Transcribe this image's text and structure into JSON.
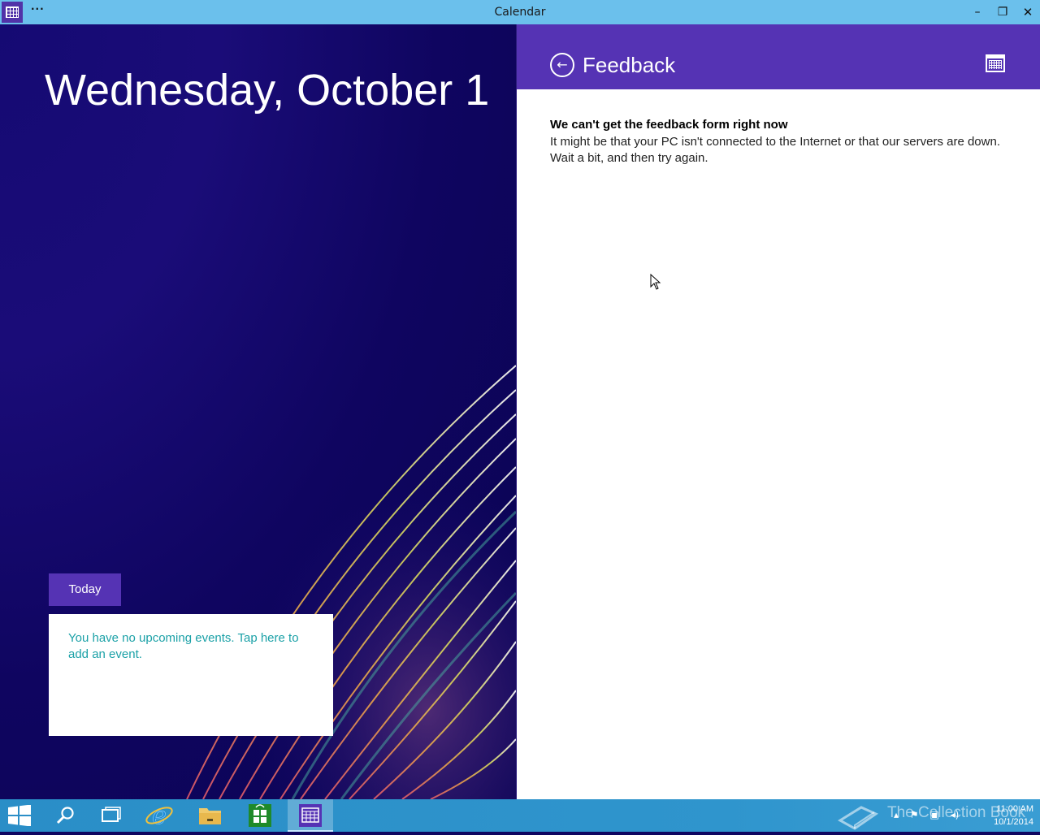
{
  "window": {
    "title": "Calendar",
    "menu_glyph": "···",
    "minimize_glyph": "–",
    "maximize_glyph": "❐",
    "close_glyph": "✕"
  },
  "calendar": {
    "date_heading": "Wednesday, October 1",
    "today_label": "Today",
    "no_events_text": "You have no upcoming events. Tap here to add an event."
  },
  "feedback": {
    "back_glyph": "←",
    "title": "Feedback",
    "error_title": "We can't get the feedback form right now",
    "error_body_line1": "It might be that your PC isn't connected to the Internet or that our servers are down.",
    "error_body_line2": "Wait a bit, and then try again."
  },
  "taskbar": {
    "items": [
      "start-icon",
      "search-icon",
      "task-view-icon",
      "internet-explorer-icon",
      "file-explorer-icon",
      "store-icon",
      "calendar-icon"
    ],
    "clock_time": "11:00 AM",
    "clock_date": "10/1/2014",
    "watermark": "The Collection Book"
  },
  "colors": {
    "titlebar": "#6bc0ec",
    "accent_purple": "#5533b4",
    "event_text": "#1ba1a7",
    "taskbar": "#2f95cd"
  }
}
